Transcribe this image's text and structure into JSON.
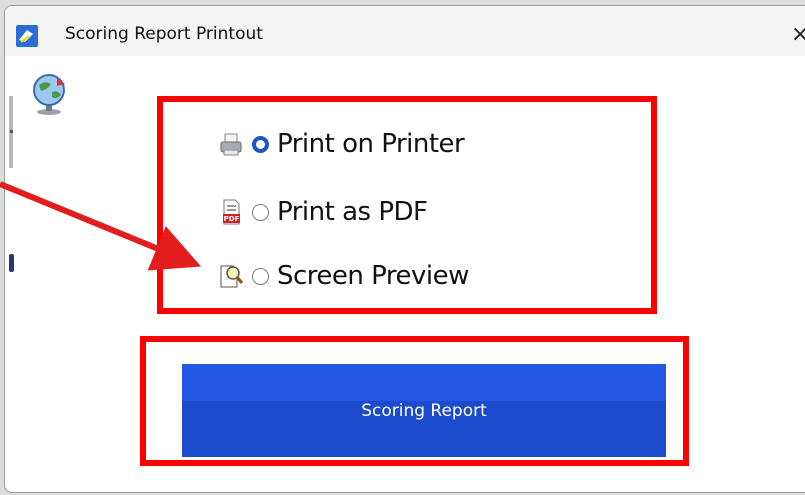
{
  "window": {
    "title": "Scoring Report Printout",
    "close_glyph": "×"
  },
  "options": [
    {
      "label": "Print on Printer",
      "icon": "printer-icon",
      "selected": true
    },
    {
      "label": "Print as PDF",
      "icon": "pdf-file-icon",
      "selected": false
    },
    {
      "label": "Screen Preview",
      "icon": "magnifier-page-icon",
      "selected": false
    }
  ],
  "action_button": {
    "label": "Scoring Report"
  },
  "colors": {
    "highlight": "#ff0000",
    "button": "#2457e2",
    "radio_selected": "#1d55c9"
  }
}
